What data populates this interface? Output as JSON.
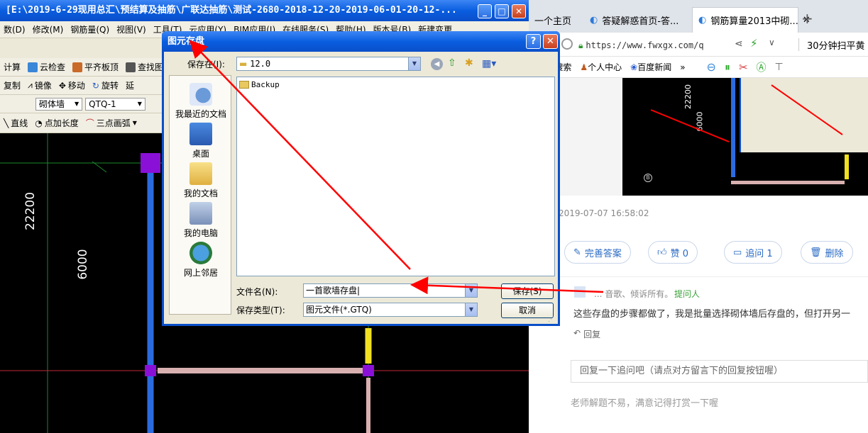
{
  "cad": {
    "title": "[E:\\2019-6-29现用总汇\\预结算及抽筋\\广联达抽筋\\测试-2680-2018-12-20-2019-06-01-20-12-...",
    "window_buttons": {
      "minimize": "_",
      "maximize": "□",
      "close": "✕"
    },
    "menu": [
      "数(D)",
      "修改(M)",
      "钢筋量(Q)",
      "视图(V)",
      "工具(T)",
      "云应用(Y)",
      "BIM应用(I)",
      "在线服务(S)",
      "帮助(H)",
      "版本号(B)",
      "新建变更"
    ],
    "toolbar1": [
      "计算",
      "云检查",
      "平齐板顶",
      "查找图元"
    ],
    "toolbar2": [
      "复制",
      "镜像",
      "移动",
      "旋转",
      "延"
    ],
    "toolbar3": {
      "layer": "砌体墙",
      "component": "QTQ-1"
    },
    "toolbar4": [
      "直线",
      "点加长度",
      "三点画弧"
    ],
    "dims": {
      "vertical_total": "22200",
      "vertical_span": "6000"
    }
  },
  "browser": {
    "tabs": [
      {
        "label": "一个主页"
      },
      {
        "label": "答疑解惑首页-答..."
      },
      {
        "label": "钢筋算量2013中砌...",
        "close": "✕",
        "active": true
      }
    ],
    "new_tab": "+",
    "url": "https://www.fwxgx.com/q",
    "promo": "30分钟扫平黄",
    "bookmarks": [
      "360搜索",
      "个人中心",
      "百度新闻",
      "»"
    ],
    "post": {
      "timestamp": "2019-07-07 16:58:02",
      "actions": [
        {
          "label": "完善答案",
          "icon": "edit-icon"
        },
        {
          "label": "赞 0",
          "icon": "thumb-up-icon"
        },
        {
          "label": "追问 1",
          "icon": "comment-icon"
        },
        {
          "label": "删除",
          "icon": "trash-icon"
        }
      ],
      "user": "... 音歌、倾诉所有。",
      "role": "提问人",
      "comment": "这些存盘的步骤都做了，我是批量选择砌体墙后存盘的，但打开另一",
      "reply_label": "回复",
      "reply_placeholder": "回复一下追问吧（请点对方留言下的回复按钮喔）",
      "footer": "老师解题不易，满意记得打赏一下喔"
    },
    "thumb": {
      "dim1": "22200",
      "dim2": "6000",
      "axis": "B"
    }
  },
  "dialog": {
    "title": "图元存盘",
    "help_btn": "?",
    "close_btn": "✕",
    "save_in_label": "保存在(I):",
    "save_in_value": "12.0",
    "places": [
      "我最近的文档",
      "桌面",
      "我的文档",
      "我的电脑",
      "网上邻居"
    ],
    "files": [
      {
        "name": "Backup",
        "type": "folder"
      }
    ],
    "filename_label": "文件名(N):",
    "filename_value": "一首歌墙存盘|",
    "filetype_label": "保存类型(T):",
    "filetype_value": "图元文件(*.GTQ)",
    "save_btn": "保存(S)",
    "cancel_btn": "取消"
  },
  "colors": {
    "xp_blue": "#0a5ee0",
    "annotation_red": "#ff0000",
    "link_blue": "#2a6ac4",
    "green_role": "#3aa13a"
  }
}
